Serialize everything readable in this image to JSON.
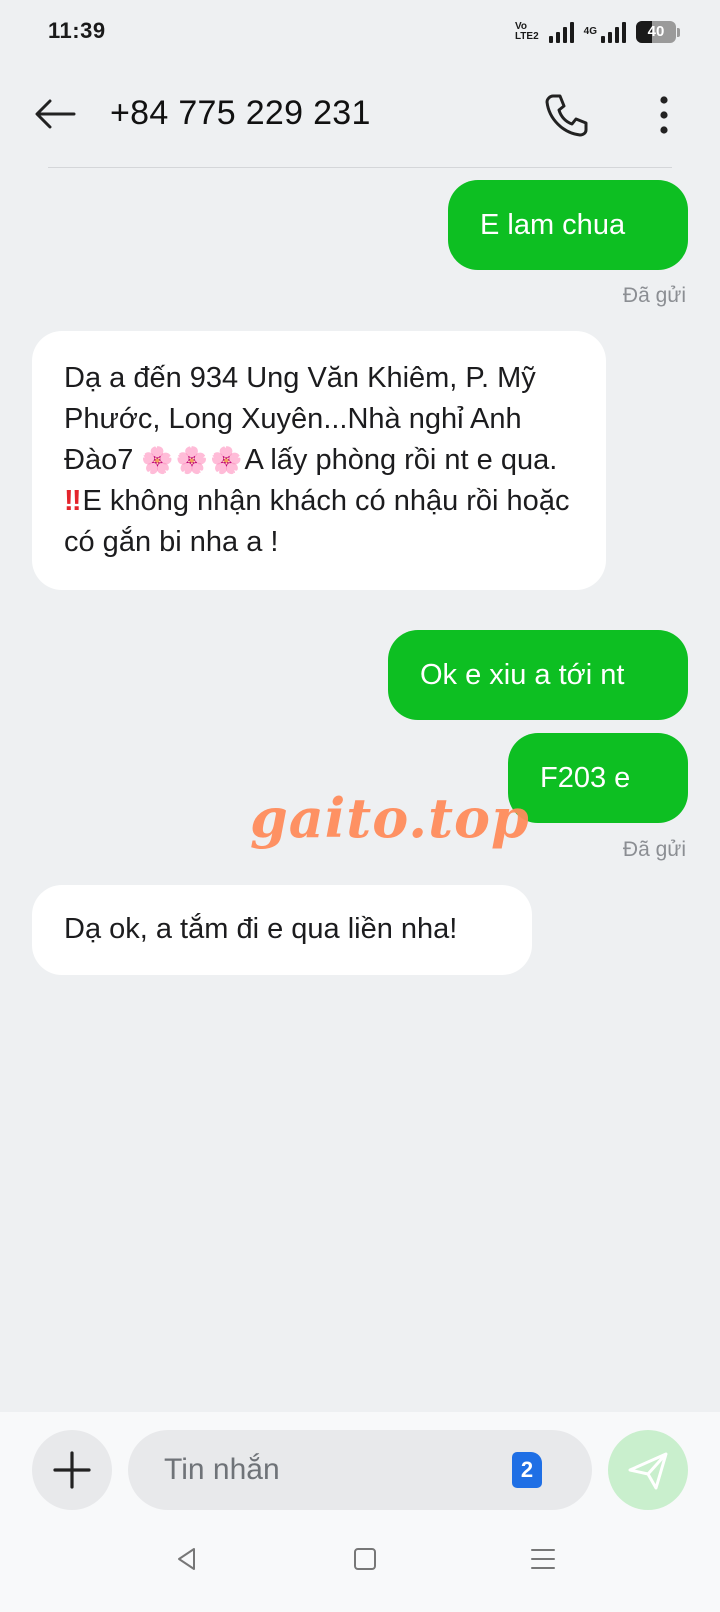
{
  "status_bar": {
    "time": "11:39",
    "volte_line1": "Vo",
    "volte_line2": "LTE2",
    "network": "4G",
    "battery": "40",
    "battery_level": 0.4
  },
  "header": {
    "title": "+84 775 229 231",
    "back_icon": "arrow-left-icon",
    "call_icon": "phone-icon",
    "more_icon": "more-vertical-icon"
  },
  "messages": [
    {
      "direction": "sent",
      "text": "E lam chua"
    },
    {
      "direction": "received",
      "text_part1": " Dạ a đến 934 Ung Văn Khiêm, P. Mỹ Phước, Long Xuyên...Nhà nghỉ  Anh Đào7 ",
      "emoji_flowers": "🌸🌸🌸",
      "text_part2": "A lấy phòng rồi nt e qua. ",
      "emoji_alert": "‼",
      "text_part3": "E không nhận khách có nhậu rồi hoặc có  gắn bi nha a !"
    },
    {
      "direction": "sent",
      "text": "Ok e xiu a tới nt"
    },
    {
      "direction": "sent",
      "text": "F203 e"
    },
    {
      "direction": "received",
      "text": "Dạ ok, a tắm đi e qua liền nha!"
    }
  ],
  "sent_status": "Đã gửi",
  "watermark": "gaito.top",
  "composer": {
    "placeholder": "Tin nhắn",
    "sim_badge": "2",
    "add_icon": "plus-icon",
    "send_icon": "send-icon"
  },
  "nav_bar": {
    "back_icon": "triangle-back-icon",
    "home_icon": "square-home-icon",
    "menu_icon": "menu-lines-icon"
  },
  "colors": {
    "sent_bubble": "#0dbf22",
    "received_bubble": "#ffffff",
    "background": "#eef0f2",
    "send_button": "#c9efcd",
    "sim_badge": "#1f6fe5",
    "watermark": "#ff8c5c"
  }
}
